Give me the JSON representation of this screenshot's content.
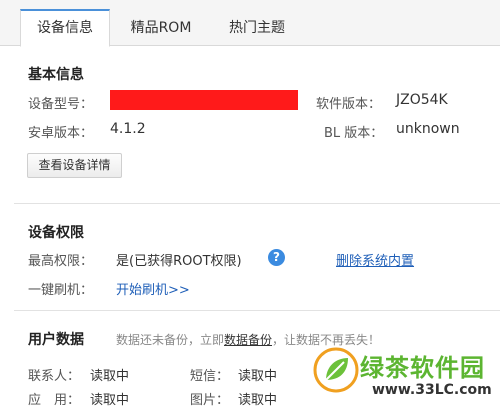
{
  "tabs": [
    {
      "label": "设备信息"
    },
    {
      "label": "精品ROM"
    },
    {
      "label": "热门主题"
    }
  ],
  "basic": {
    "title": "基本信息",
    "model_label": "设备型号：",
    "software_label": "软件版本：",
    "software_value": "JZO54K",
    "android_label": "安卓版本：",
    "android_value": "4.1.2",
    "bl_label": "BL 版本：",
    "bl_value": "unknown",
    "details_button": "查看设备详情"
  },
  "permissions": {
    "title": "设备权限",
    "root_label": "最高权限：",
    "root_value": "是(已获得ROOT权限)",
    "remove_link": "删除系统内置",
    "flash_label": "一键刷机：",
    "flash_link": "开始刷机>>"
  },
  "userdata": {
    "title": "用户数据",
    "note_prefix": "数据还未备份，立即",
    "note_link": "数据备份",
    "note_suffix": "，让数据不再丢失！",
    "contacts_label": "联系人：",
    "contacts_value": "读取中",
    "sms_label": "短信：",
    "sms_value": "读取中",
    "apps_label": "应　用：",
    "apps_value": "读取中",
    "photos_label": "图片：",
    "photos_value": "读取中"
  },
  "watermark": {
    "name": "绿茶软件园",
    "url": "www.33LC.com"
  },
  "colors": {
    "accent": "#4a90d9",
    "link": "#1f5fb8",
    "redaction": "#ff1a1a",
    "watermark_green": "#5cb531"
  }
}
